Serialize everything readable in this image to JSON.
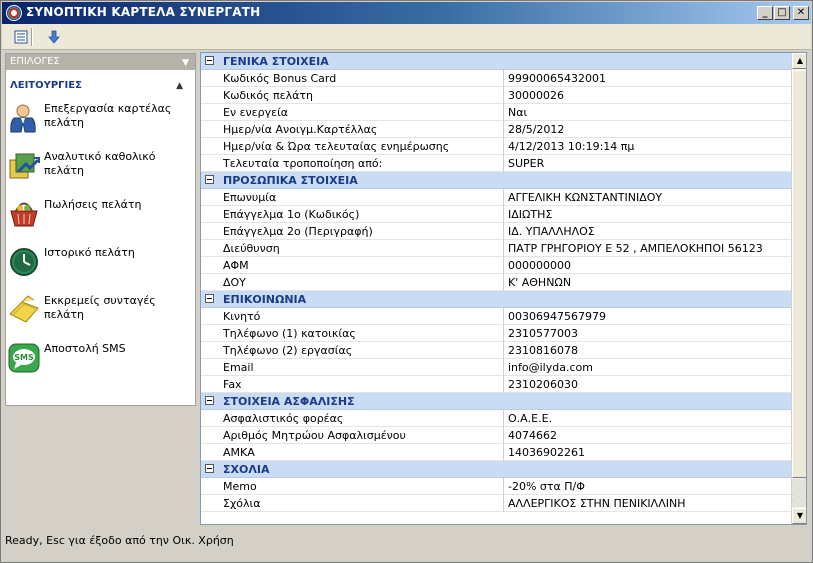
{
  "window": {
    "title": "ΣΥΝΟΠΤΙΚΗ ΚΑΡΤΕΛΑ ΣΥΝΕΡΓΑΤΗ",
    "controls": {
      "minimize": "_",
      "maximize": "□",
      "close": "✕"
    }
  },
  "toolbar": {
    "icons": [
      "list-view-icon",
      "arrow-down-icon"
    ]
  },
  "sidebar": {
    "options_label": "ΕΠΙΛΟΓΕΣ",
    "functions_label": "ΛΕΙΤΟΥΡΓΙΕΣ",
    "items": [
      {
        "label": "Επεξεργασία καρτέλας πελάτη",
        "icon": "user-icon"
      },
      {
        "label": "Αναλυτικό καθολικό πελάτη",
        "icon": "ledger-icon"
      },
      {
        "label": "Πωλήσεις πελάτη",
        "icon": "basket-icon"
      },
      {
        "label": "Ιστορικό πελάτη",
        "icon": "clock-icon"
      },
      {
        "label": "Εκκρεμείς συνταγές πελάτη",
        "icon": "folder-icon"
      },
      {
        "label": "Αποστολή SMS",
        "icon": "sms-icon"
      }
    ]
  },
  "grid": {
    "sections": [
      {
        "title": "ΓΕΝΙΚΑ ΣΤΟΙΧΕΙΑ",
        "rows": [
          {
            "key": "Κωδικός Bonus Card",
            "value": "99900065432001"
          },
          {
            "key": "Κωδικός πελάτη",
            "value": "30000026"
          },
          {
            "key": "Εν ενεργεία",
            "value": "Ναι"
          },
          {
            "key": "Ημερ/νία Ανοιγμ.Καρτέλλας",
            "value": "28/5/2012"
          },
          {
            "key": "Ημερ/νία & Ώρα τελευταίας ενημέρωσης",
            "value": "4/12/2013 10:19:14 πμ"
          },
          {
            "key": "Τελευταία τροποποίηση από:",
            "value": "SUPER"
          }
        ]
      },
      {
        "title": "ΠΡΟΣΩΠΙΚΑ ΣΤΟΙΧΕΙΑ",
        "rows": [
          {
            "key": "Επωνυμία",
            "value": "ΑΓΓΕΛΙΚΗ ΚΩΝΣΤΑΝΤΙΝΙΔΟΥ"
          },
          {
            "key": "Επάγγελμα 1ο (Κωδικός)",
            "value": "ΙΔΙΩΤΗΣ"
          },
          {
            "key": "Επάγγελμα 2ο (Περιγραφή)",
            "value": "ΙΔ. ΥΠΑΛΛΗΛΟΣ"
          },
          {
            "key": "Διεύθυνση",
            "value": "ΠΑΤΡ ΓΡΗΓΟΡΙΟΥ Ε 52 , ΑΜΠΕΛΟΚΗΠΟΙ 56123"
          },
          {
            "key": "ΑΦΜ",
            "value": "000000000"
          },
          {
            "key": "ΔΟΥ",
            "value": "Κ' ΑΘΗΝΩΝ"
          }
        ]
      },
      {
        "title": "ΕΠΙΚΟΙΝΩΝΙΑ",
        "rows": [
          {
            "key": "Κινητό",
            "value": "00306947567979"
          },
          {
            "key": "Τηλέφωνο (1) κατοικίας",
            "value": "2310577003"
          },
          {
            "key": "Τηλέφωνο (2) εργασίας",
            "value": "2310816078"
          },
          {
            "key": "Email",
            "value": "info@ilyda.com"
          },
          {
            "key": "Fax",
            "value": "2310206030"
          }
        ]
      },
      {
        "title": "ΣΤΟΙΧΕΙΑ ΑΣΦΑΛΙΣΗΣ",
        "rows": [
          {
            "key": "Ασφαλιστικός φορέας",
            "value": "Ο.Α.Ε.Ε."
          },
          {
            "key": "Αριθμός Μητρώου Ασφαλισμένου",
            "value": "4074662"
          },
          {
            "key": "ΑΜΚΑ",
            "value": "14036902261"
          }
        ]
      },
      {
        "title": "ΣΧΟΛΙΑ",
        "rows": [
          {
            "key": "Memo",
            "value": "-20% στα Π/Φ"
          },
          {
            "key": "Σχόλια",
            "value": "ΑΛΛΕΡΓΙΚΟΣ ΣΤΗΝ ΠΕΝΙΚΙΛΛΙΝΗ"
          }
        ]
      }
    ]
  },
  "status": {
    "text": "Ready, Esc για έξοδο από την Οικ. Χρήση"
  }
}
